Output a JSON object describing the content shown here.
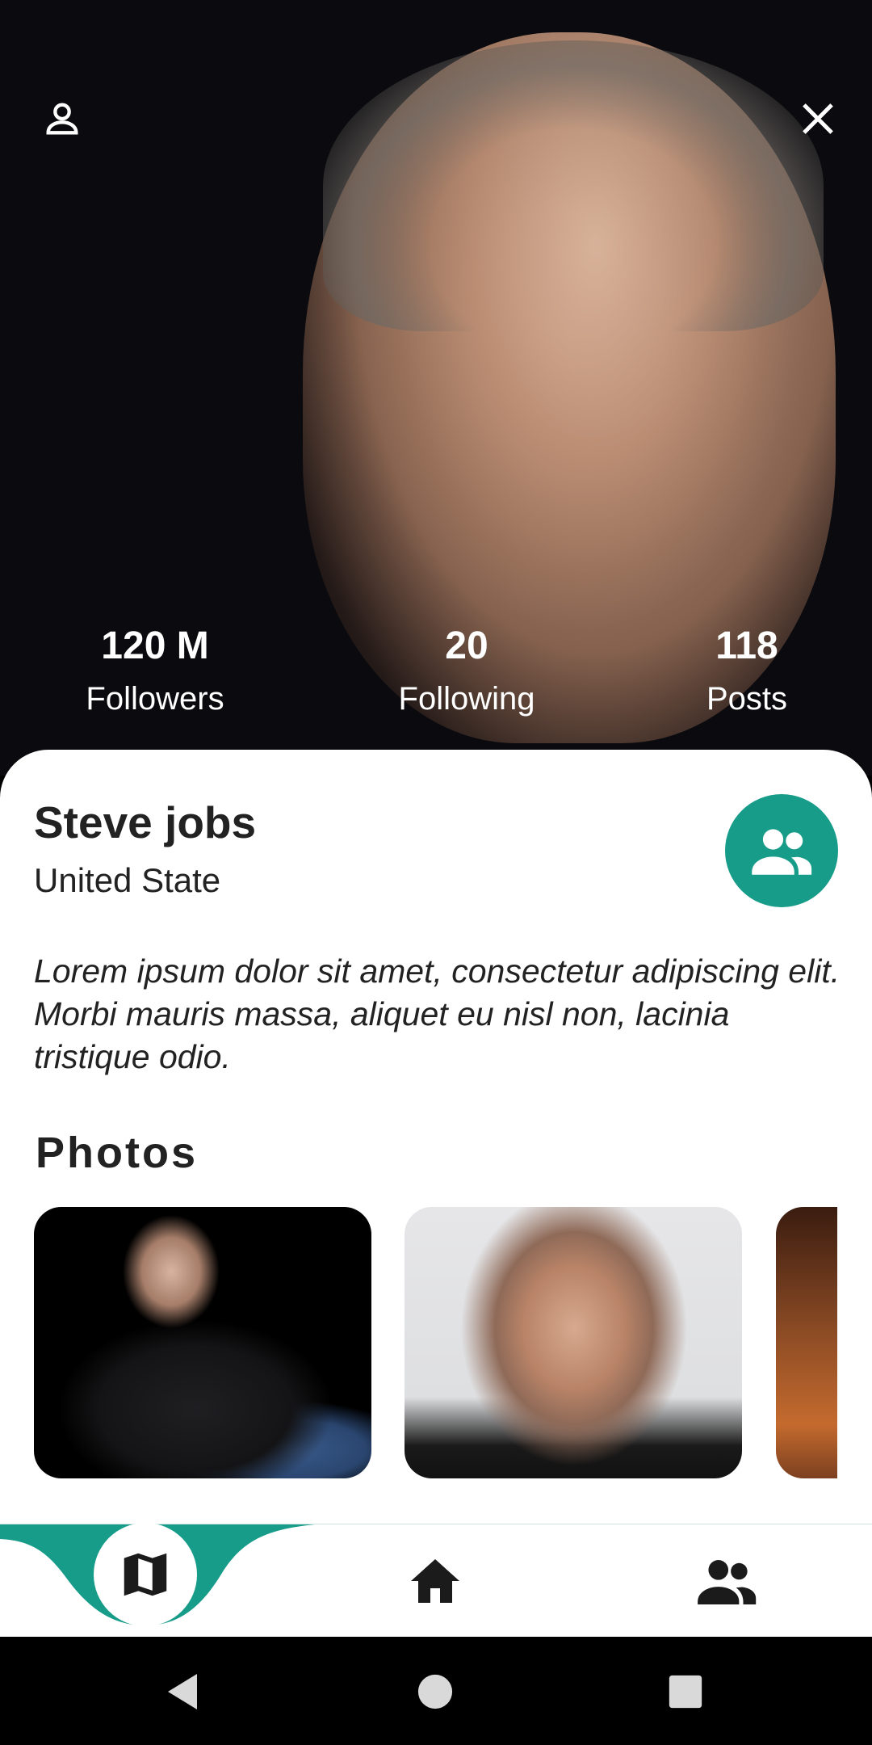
{
  "header": {
    "profile_icon": "person-outline-icon",
    "close_icon": "close-icon"
  },
  "stats": [
    {
      "value": "120  M",
      "label": "Followers"
    },
    {
      "value": "20",
      "label": "Following"
    },
    {
      "value": "118",
      "label": "Posts"
    }
  ],
  "profile": {
    "name": "Steve jobs",
    "location": "United State",
    "bio": "Lorem ipsum dolor sit amet, consectetur adipiscing elit. Morbi mauris massa, aliquet eu nisl non, lacinia tristique odio."
  },
  "photos": {
    "title": "Photos"
  },
  "colors": {
    "accent": "#169c89",
    "text": "#222222"
  },
  "bottom_nav": {
    "items": [
      "map-icon",
      "home-icon",
      "people-icon"
    ],
    "active": "map-icon"
  }
}
